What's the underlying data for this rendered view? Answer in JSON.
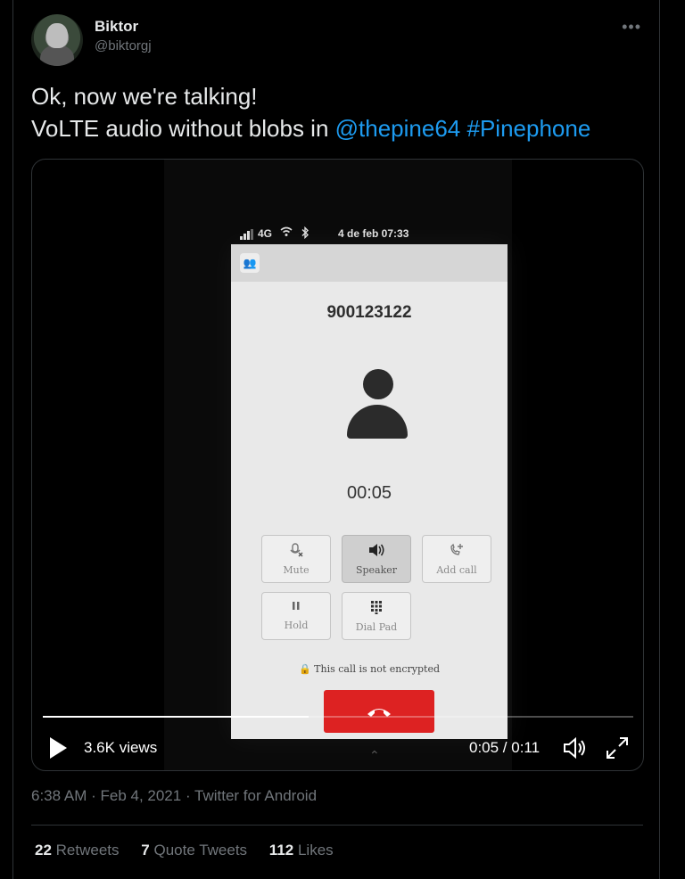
{
  "author": {
    "display_name": "Biktor",
    "handle": "@biktorgj",
    "more_label": "•••"
  },
  "tweet": {
    "line1": "Ok, now we're talking!",
    "line2_prefix": "VoLTE audio without blobs in ",
    "mention": "@thepine64",
    "hashtag": "#Pinephone"
  },
  "video": {
    "phone_status": {
      "network": "4G",
      "date_time": "4 de feb 07:33"
    },
    "call": {
      "number": "900123122",
      "timer": "00:05",
      "buttons": [
        {
          "label": "Mute",
          "icon": "mic-off-icon",
          "glyph": "🎙",
          "active": false
        },
        {
          "label": "Speaker",
          "icon": "speaker-icon",
          "glyph": "🔊",
          "active": true
        },
        {
          "label": "Add call",
          "icon": "add-call-icon",
          "glyph": "☎+",
          "active": false
        },
        {
          "label": "Hold",
          "icon": "pause-icon",
          "glyph": "‖",
          "active": false
        },
        {
          "label": "Dial Pad",
          "icon": "dialpad-icon",
          "glyph": "∷",
          "active": false
        }
      ],
      "encryption_notice": "This call is not encrypted",
      "hangup_icon": "hangup-icon"
    },
    "controls": {
      "views": "3.6K views",
      "time": "0:05 / 0:11",
      "progress_fraction": 0.45
    }
  },
  "meta": {
    "timestamp": "6:38 AM · Feb 4, 2021 · Twitter for Android"
  },
  "stats": {
    "retweets_count": "22",
    "retweets_label": "Retweets",
    "quotes_count": "7",
    "quotes_label": "Quote Tweets",
    "likes_count": "112",
    "likes_label": "Likes"
  },
  "colors": {
    "background": "#000000",
    "link": "#1d9bf0",
    "secondary_text": "#71767b",
    "hangup": "#dd2222"
  }
}
